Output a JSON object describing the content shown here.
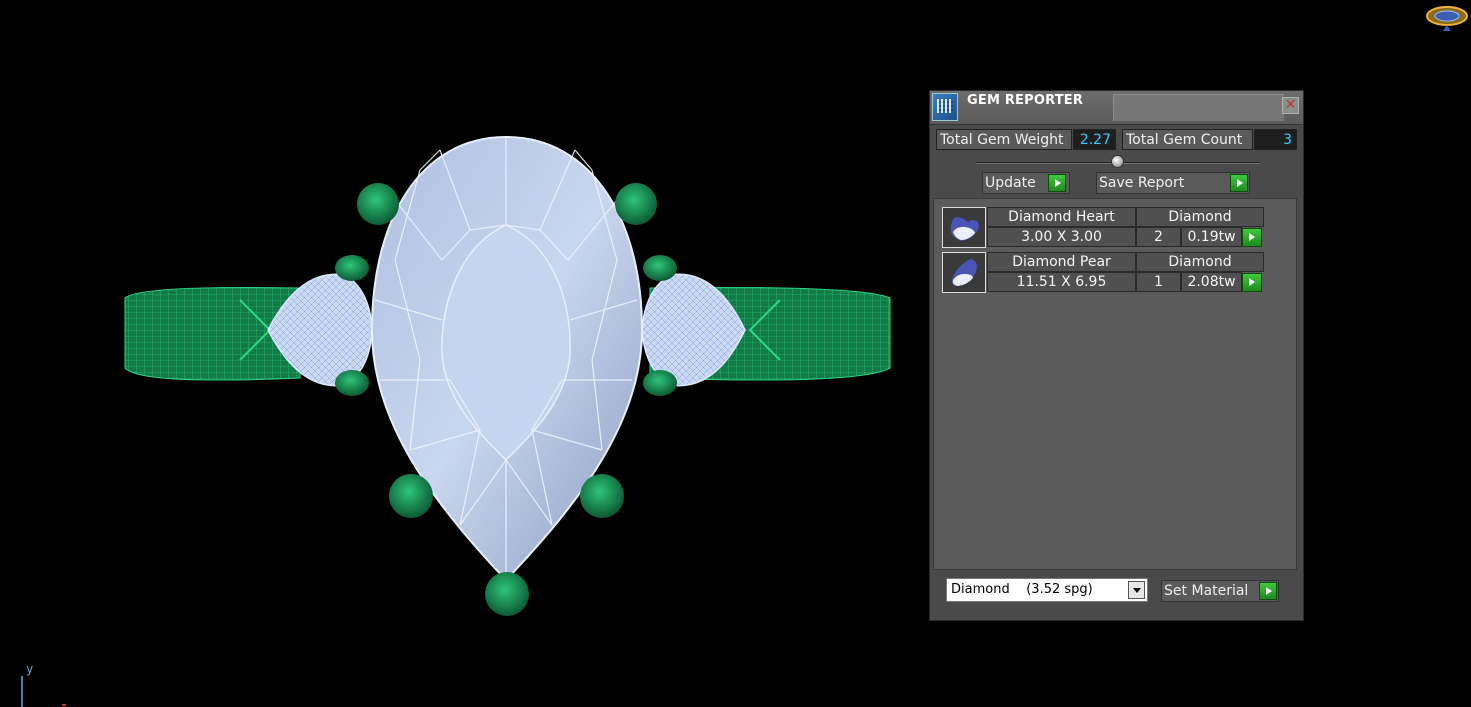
{
  "panel": {
    "title": "GEM REPORTER",
    "total_gem_weight_label": "Total Gem Weight",
    "total_gem_weight_value": "2.27",
    "total_gem_count_label": "Total Gem Count",
    "total_gem_count_value": "3",
    "update_label": "Update",
    "save_report_label": "Save Report",
    "gems": [
      {
        "name": "Diamond Heart",
        "material": "Diamond",
        "size": "3.00 X 3.00",
        "qty": "2",
        "weight": "0.19tw",
        "icon": "heart-gem-icon"
      },
      {
        "name": "Diamond Pear",
        "material": "Diamond",
        "size": "11.51 X 6.95",
        "qty": "1",
        "weight": "2.08tw",
        "icon": "pear-gem-icon"
      }
    ],
    "material_select_value": "Diamond    (3.52 spg)",
    "set_material_label": "Set Material"
  },
  "viewport": {
    "axis_label": "y"
  },
  "colors": {
    "value_text": "#33ccff",
    "wire_green": "#1fa060",
    "gem_blue": "#b8cdf0",
    "play_green": "#2fb82f"
  }
}
